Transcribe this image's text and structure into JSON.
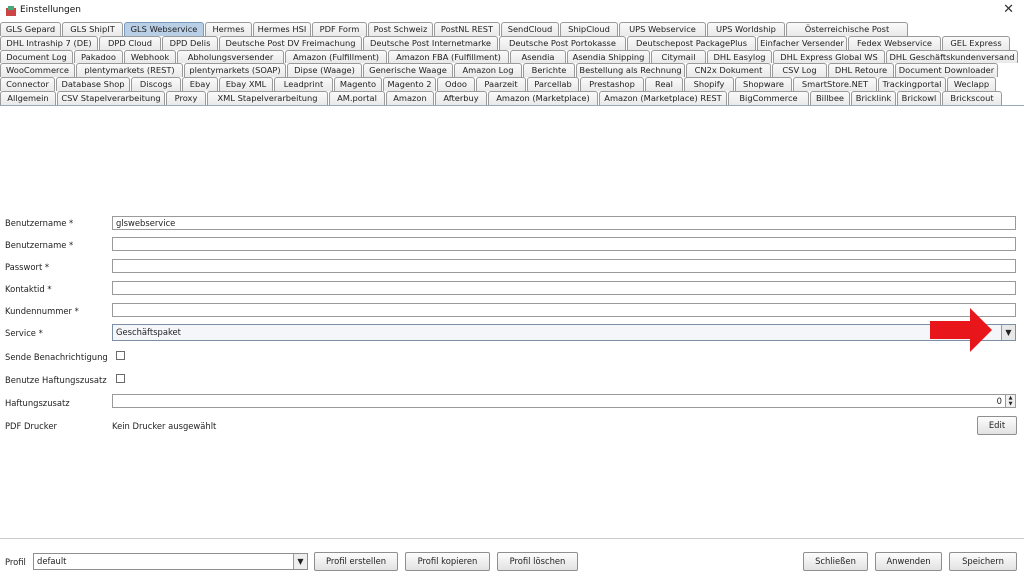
{
  "window": {
    "title": "Einstellungen",
    "close_label": "✕"
  },
  "tabs": {
    "row1": [
      "GLS Gepard",
      "GLS ShipIT",
      "GLS Webservice",
      "Hermes",
      "Hermes HSI",
      "PDF Form",
      "Post Schweiz",
      "PostNL REST",
      "SendCloud",
      "ShipCloud",
      "UPS Webservice",
      "UPS Worldship",
      "Österreichische Post"
    ],
    "row2": [
      "DHL Intraship 7 (DE)",
      "DPD Cloud",
      "DPD Delis",
      "Deutsche Post DV Freimachung",
      "Deutsche Post Internetmarke",
      "Deutsche Post Portokasse",
      "Deutschepost PackagePlus",
      "Einfacher Versender",
      "Fedex Webservice",
      "GEL Express"
    ],
    "row3": [
      "Document Log",
      "Pakadoo",
      "Webhook",
      "Abholungsversender",
      "Amazon (Fulfillment)",
      "Amazon FBA (Fulfillment)",
      "Asendia",
      "Asendia Shipping",
      "Citymail",
      "DHL Easylog",
      "DHL Express Global WS",
      "DHL Geschäftskundenversand"
    ],
    "row4": [
      "WooCommerce",
      "plentymarkets (REST)",
      "plentymarkets (SOAP)",
      "Dipse (Waage)",
      "Generische Waage",
      "Amazon Log",
      "Berichte",
      "Bestellung als Rechnung",
      "CN2x Dokument",
      "CSV Log",
      "DHL Retoure",
      "Document Downloader"
    ],
    "row5": [
      "Connector",
      "Database Shop",
      "Discogs",
      "Ebay",
      "Ebay XML",
      "Leadprint",
      "Magento",
      "Magento 2",
      "Odoo",
      "Paarzeit",
      "Parcellab",
      "Prestashop",
      "Real",
      "Shopify",
      "Shopware",
      "SmartStore.NET",
      "Trackingportal",
      "Weclapp"
    ],
    "row6": [
      "Allgemein",
      "CSV Stapelverarbeitung",
      "Proxy",
      "XML Stapelverarbeitung",
      "AM.portal",
      "Amazon",
      "Afterbuy",
      "Amazon (Marketplace)",
      "Amazon (Marketplace) REST",
      "BigCommerce",
      "Billbee",
      "Bricklink",
      "Brickowl",
      "Brickscout"
    ],
    "selected": "GLS Webservice"
  },
  "form": {
    "username1_label": "Benutzername *",
    "username1_value": "glswebservice",
    "username2_label": "Benutzername *",
    "username2_value": "",
    "password_label": "Passwort *",
    "password_value": "",
    "contact_label": "Kontaktid *",
    "contact_value": "",
    "customer_label": "Kundennummer *",
    "customer_value": "",
    "service_label": "Service *",
    "service_value": "Geschäftspaket",
    "notify_label": "Sende Benachrichtigung",
    "liability_label": "Benutze Haftungszusatz",
    "liability_amount_label": "Haftungszusatz",
    "liability_amount_value": "0",
    "pdf_label": "PDF Drucker",
    "pdf_value": "Kein Drucker ausgewählt",
    "edit_label": "Edit"
  },
  "bottom": {
    "profile_label": "Profil",
    "profile_value": "default",
    "create_label": "Profil erstellen",
    "copy_label": "Profil kopieren",
    "delete_label": "Profil löschen",
    "close_label": "Schließen",
    "apply_label": "Anwenden",
    "save_label": "Speichern"
  },
  "colors": {
    "annotation_arrow": "#e8161b",
    "selected_tab": "#b8cfe5"
  }
}
